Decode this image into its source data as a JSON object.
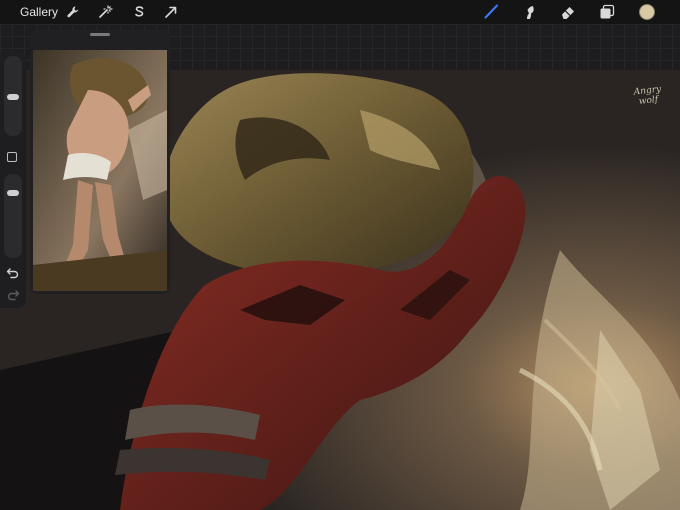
{
  "toolbar": {
    "gallery_label": "Gallery",
    "left_tools": [
      "wrench-icon",
      "magic-wand-icon",
      "selection-icon",
      "transform-arrow-icon"
    ],
    "right_tools": [
      "brush-icon",
      "smudge-icon",
      "eraser-icon",
      "layers-icon"
    ],
    "active_tool": "brush-icon",
    "active_color": "#d6c9a3",
    "accent": "#3a7bff"
  },
  "canvas": {
    "signature_line1": "Angry",
    "signature_line2": "wolf"
  },
  "sidebar": {
    "brush_size_level": 0.52,
    "opacity_level": 0.7
  }
}
